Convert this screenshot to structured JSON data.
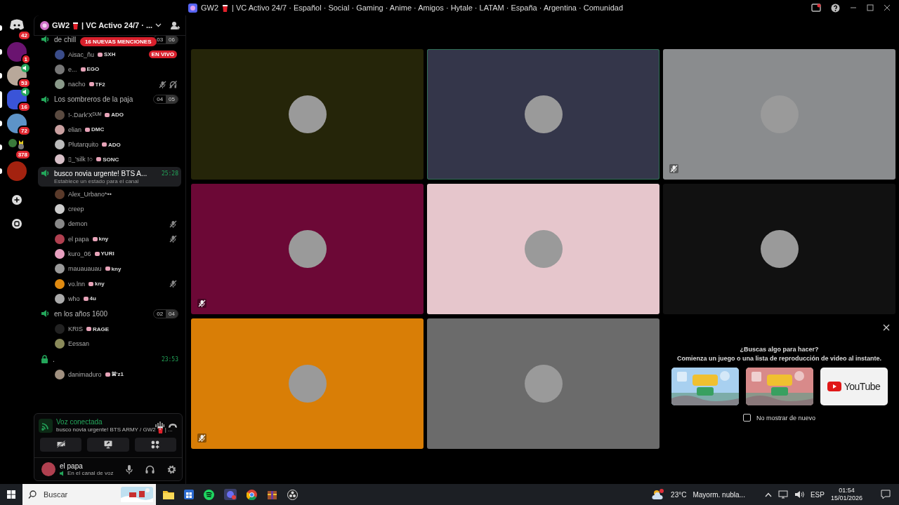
{
  "window": {
    "title": "GW2",
    "title_suffix": "| VC Activo 24/7 · Español · Social · Gaming · Anime · Amigos · Hytale · LATAM · España · Argentina · Comunidad"
  },
  "servers": [
    {
      "kind": "home",
      "badge": "42",
      "selected": false,
      "voice": false
    },
    {
      "kind": "server",
      "badge": "1",
      "selected": false,
      "voice": false,
      "color": "#6a1470"
    },
    {
      "kind": "server",
      "badge": "53",
      "selected": false,
      "voice": true,
      "color": "#b8a89a"
    },
    {
      "kind": "server",
      "badge": "16",
      "selected": true,
      "voice": true,
      "color": "#3a54d8"
    },
    {
      "kind": "server",
      "badge": "72",
      "selected": false,
      "voice": false,
      "color": "#5d93c8"
    },
    {
      "kind": "folder",
      "badge": "378",
      "selected": false,
      "voice": false
    },
    {
      "kind": "server",
      "selected": false,
      "voice": false,
      "color": "#a3220f"
    }
  ],
  "server_header": {
    "name": "GW2",
    "name_suffix": "| VC Activo 24/7 · ..."
  },
  "mentions_badge": "16 NUEVAS MENCIONES",
  "channels": [
    {
      "kind": "voice",
      "name": "de chill",
      "counts": [
        "03",
        "06"
      ],
      "selected": false,
      "users": [
        {
          "name": "Aisac_ñu",
          "tag": "SXH",
          "live": "EN VIVO",
          "muted": false,
          "deafened": false,
          "color": "#3a4c8a"
        },
        {
          "name": "e...",
          "tag": "EGO",
          "muted": false,
          "deafened": false,
          "color": "#777777"
        },
        {
          "name": "nacho",
          "tag": "TF2",
          "muted": true,
          "deafened": true,
          "color": "#8a9a8a"
        }
      ]
    },
    {
      "kind": "voice",
      "name": "Los sombreros de la paja",
      "counts": [
        "04",
        "05"
      ],
      "selected": false,
      "users": [
        {
          "name": "!-.Dark'Xᴰᵁᴹ",
          "tag": "ADO",
          "muted": false,
          "deafened": false,
          "color": "#5a4a40"
        },
        {
          "name": "elian",
          "tag": "DMC",
          "muted": false,
          "deafened": false,
          "color": "#c9a0a0"
        },
        {
          "name": "Plutarquito",
          "tag": "ADO",
          "muted": false,
          "deafened": false,
          "color": "#bbbbbb"
        },
        {
          "name": "▯_'silk !○",
          "tag": "SONC",
          "muted": false,
          "deafened": false,
          "color": "#d8c0c8"
        }
      ]
    },
    {
      "kind": "voice",
      "name": "busco novia urgente! BTS A...",
      "timer": "25:28",
      "status": "Establece un estado para el canal",
      "selected": true,
      "users": [
        {
          "name": "Alex_Urbano*••",
          "muted": false,
          "deafened": false,
          "color": "#5a3a2a"
        },
        {
          "name": "creep",
          "muted": false,
          "deafened": false,
          "color": "#cccccc"
        },
        {
          "name": "demon",
          "muted": true,
          "deafened": false,
          "color": "#888888"
        },
        {
          "name": "el papa",
          "tag": "kny",
          "muted": true,
          "deafened": false,
          "color": "#b04050"
        },
        {
          "name": "kuro_06",
          "tag": "YURI",
          "muted": false,
          "deafened": false,
          "color": "#e8a0c0"
        },
        {
          "name": "mauauauau",
          "tag": "kny",
          "muted": false,
          "deafened": false,
          "color": "#9a9a9a"
        },
        {
          "name": "vo.lnn",
          "tag": "kny",
          "muted": true,
          "deafened": false,
          "color": "#e08a10"
        },
        {
          "name": "who",
          "tag": "4u",
          "muted": false,
          "deafened": false,
          "color": "#aaaaaa"
        }
      ]
    },
    {
      "kind": "voice",
      "name": "en los años 1600",
      "counts": [
        "02",
        "04"
      ],
      "selected": false,
      "users": [
        {
          "name": "KRIS",
          "tag": "RAGE",
          "muted": false,
          "deafened": false,
          "color": "#222222"
        },
        {
          "name": "Eessan",
          "muted": false,
          "deafened": false,
          "color": "#8a8a5a"
        }
      ]
    },
    {
      "kind": "locked",
      "name": ".",
      "timer": "23:53",
      "selected": false,
      "users": [
        {
          "name": "danimaduro",
          "tag": "ꕤ'z1",
          "muted": false,
          "deafened": false,
          "color": "#a09080"
        }
      ]
    }
  ],
  "voice_panel": {
    "title": "Voz conectada",
    "channel": "busco novia urgente! BTS ARMY / GW2",
    "channel_suffix": "| ..."
  },
  "user_panel": {
    "name": "el papa",
    "status": "En el canal de voz"
  },
  "video_tiles": [
    {
      "color": "#252509",
      "muted": false,
      "speaking": false
    },
    {
      "color": "#34364a",
      "muted": false,
      "speaking": true
    },
    {
      "color": "#8a8c8e",
      "muted": true,
      "speaking": false
    },
    {
      "color": "#6c0836",
      "muted": true,
      "speaking": false
    },
    {
      "color": "#e6c6cc",
      "muted": false,
      "speaking": false
    },
    {
      "color": "#111111",
      "muted": false,
      "speaking": false
    },
    {
      "color": "#d97e06",
      "muted": true,
      "speaking": false
    },
    {
      "color": "#6b6b6b",
      "muted": false,
      "speaking": false
    }
  ],
  "activity": {
    "title": "¿Buscas algo para hacer?",
    "subtitle": "Comienza un juego o una lista de reproducción de video al instante.",
    "games": [
      {
        "kind": "picture",
        "color": "#a8d0f0"
      },
      {
        "kind": "picture",
        "color": "#d88a8a"
      },
      {
        "kind": "youtube",
        "label": "YouTube"
      }
    ],
    "dont_show": {
      "label": "No mostrar de nuevo",
      "checked": false
    }
  },
  "taskbar": {
    "search_placeholder": "Buscar",
    "weather_temp": "23°C",
    "weather_text": "Mayorm. nubla...",
    "language": "ESP",
    "time": "01:54",
    "date": "15/01/2026"
  }
}
